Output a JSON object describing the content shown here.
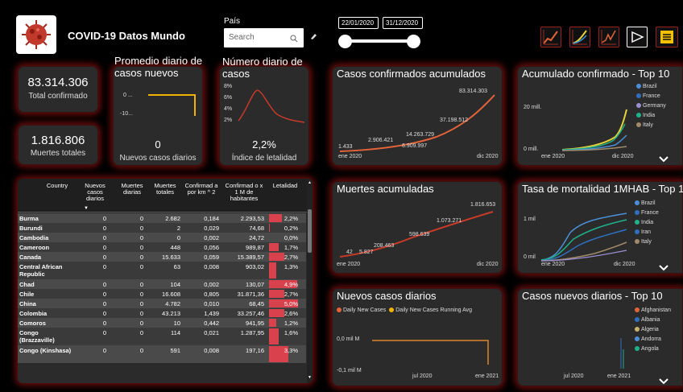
{
  "header": {
    "title": "COVID-19 Datos Mundo",
    "filter_label": "País",
    "search_placeholder": "Search",
    "date_from": "22/01/2020",
    "date_to": "31/12/2020"
  },
  "kpis": {
    "total_confirmed": "83.314.306",
    "total_confirmed_label": "Total confirmado",
    "total_deaths": "1.816.806",
    "total_deaths_label": "Muertes totales"
  },
  "avg_daily": {
    "title_line1": "Promedio diario de",
    "title_line2": "casos nuevos",
    "tick_top": "0 ...",
    "tick_bottom": "-10...",
    "value": "0",
    "label": "Nuevos casos diarios"
  },
  "daily_count": {
    "title_line1": "Número diario de",
    "title_line2": "casos",
    "ticks": [
      "8%",
      "6%",
      "4%",
      "2%"
    ],
    "value": "2,2%",
    "label": "Índice de letalidad"
  },
  "cumulative_cases": {
    "title": "Casos confirmados acumulados",
    "labels": [
      "1.433",
      "2.906.421",
      "6.909.997",
      "14.263.729",
      "37.198.512",
      "83.314.303"
    ],
    "x_start": "ene 2020",
    "x_end": "dic 2020"
  },
  "top10_cumulative": {
    "title": "Acumulado confirmado - Top 10",
    "y_top": "20 mill.",
    "y_bottom": "0 mill.",
    "x_start": "ene 2020",
    "x_end": "dic 2020",
    "legend": [
      {
        "name": "Brazil",
        "color": "#4a90d9"
      },
      {
        "name": "France",
        "color": "#2f6fbf"
      },
      {
        "name": "Germany",
        "color": "#9b8fd0"
      },
      {
        "name": "India",
        "color": "#1fb28a"
      },
      {
        "name": "Italy",
        "color": "#a08a6a"
      }
    ]
  },
  "cumulative_deaths": {
    "title": "Muertes acumuladas",
    "labels": [
      "42",
      "5.827",
      "208.463",
      "598.639",
      "1.073.271",
      "1.816.653"
    ],
    "x_start": "ene 2020",
    "x_end": "dic 2020"
  },
  "mortality_top10": {
    "title": "Tasa de mortalidad 1MHAB - Top 10",
    "y_top": "1 mil",
    "y_bottom": "0 mil",
    "x_start": "ene 2020",
    "x_end": "dic 2020",
    "legend": [
      {
        "name": "Brazil",
        "color": "#4a90d9"
      },
      {
        "name": "France",
        "color": "#2f6fbf"
      },
      {
        "name": "India",
        "color": "#1fb28a"
      },
      {
        "name": "Iran",
        "color": "#2f6fbf"
      },
      {
        "name": "Italy",
        "color": "#a08a6a"
      }
    ]
  },
  "new_daily": {
    "title": "Nuevos casos diarios",
    "legend_a": "Daily New Cases",
    "legend_b": "Daily New Cases Running Avg",
    "y_top": "0,0 mil M",
    "y_bottom": "-0,1 mil M",
    "x_mid": "jul 2020",
    "x_end": "ene 2021"
  },
  "new_daily_top10": {
    "title": "Casos nuevos diarios - Top 10",
    "x_mid": "jul 2020",
    "x_end": "ene 2021",
    "legend": [
      {
        "name": "Afghanistan",
        "color": "#e4643a"
      },
      {
        "name": "Albania",
        "color": "#2f6fbf"
      },
      {
        "name": "Algeria",
        "color": "#c9b26a"
      },
      {
        "name": "Andorra",
        "color": "#4a90d9"
      },
      {
        "name": "Angola",
        "color": "#1fb28a"
      }
    ]
  },
  "table": {
    "headers": [
      "Country",
      "Nuevos casos diarios",
      "Muertes diarias",
      "Muertes totales",
      "Confirmad a por km ^ 2",
      "Confirmad o x 1 M de habitantes",
      "Letalidad"
    ],
    "rows": [
      {
        "country": "Burma",
        "new": "0",
        "deaths": "0",
        "total": "2.682",
        "km": "0,184",
        "m": "2.293,53",
        "let": "2,2%",
        "bar": 0.45
      },
      {
        "country": "Burundi",
        "new": "0",
        "deaths": "0",
        "total": "2",
        "km": "0,029",
        "m": "74,68",
        "let": "0,2%",
        "bar": 0.04
      },
      {
        "country": "Cambodia",
        "new": "0",
        "deaths": "0",
        "total": "0",
        "km": "0,002",
        "m": "24,72",
        "let": "0,0%",
        "bar": 0.0
      },
      {
        "country": "Cameroon",
        "new": "0",
        "deaths": "0",
        "total": "448",
        "km": "0,056",
        "m": "989,87",
        "let": "1,7%",
        "bar": 0.34
      },
      {
        "country": "Canada",
        "new": "0",
        "deaths": "0",
        "total": "15.633",
        "km": "0,059",
        "m": "15.389,57",
        "let": "2,7%",
        "bar": 0.54
      },
      {
        "country": "Central African Republic",
        "new": "0",
        "deaths": "0",
        "total": "63",
        "km": "0,008",
        "m": "903,02",
        "let": "1,3%",
        "bar": 0.26
      },
      {
        "country": "Chad",
        "new": "0",
        "deaths": "0",
        "total": "104",
        "km": "0,002",
        "m": "130,07",
        "let": "4,9%",
        "bar": 0.98
      },
      {
        "country": "Chile",
        "new": "0",
        "deaths": "0",
        "total": "16.608",
        "km": "0,805",
        "m": "31.871,36",
        "let": "2,7%",
        "bar": 0.54
      },
      {
        "country": "China",
        "new": "0",
        "deaths": "0",
        "total": "4.782",
        "km": "0,010",
        "m": "68,45",
        "let": "5,0%",
        "bar": 1.0
      },
      {
        "country": "Colombia",
        "new": "0",
        "deaths": "0",
        "total": "43.213",
        "km": "1,439",
        "m": "33.257,46",
        "let": "2,6%",
        "bar": 0.52
      },
      {
        "country": "Comoros",
        "new": "0",
        "deaths": "0",
        "total": "10",
        "km": "0,442",
        "m": "941,95",
        "let": "1,2%",
        "bar": 0.24
      },
      {
        "country": "Congo (Brazzaville)",
        "new": "0",
        "deaths": "0",
        "total": "114",
        "km": "0,021",
        "m": "1.287,95",
        "let": "1,6%",
        "bar": 0.32
      },
      {
        "country": "Congo (Kinshasa)",
        "new": "0",
        "deaths": "0",
        "total": "591",
        "km": "0,008",
        "m": "197,16",
        "let": "3,3%",
        "bar": 0.66
      }
    ]
  }
}
